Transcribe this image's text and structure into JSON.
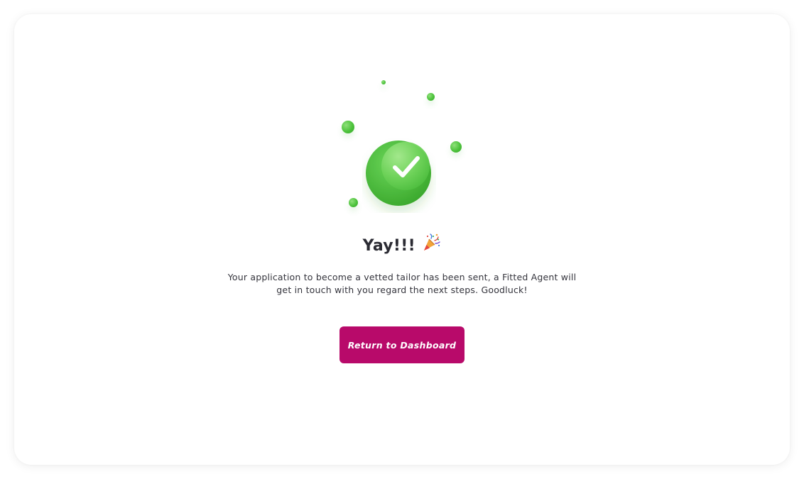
{
  "success": {
    "title": "Yay!!!",
    "message": "Your application to become a vetted tailor has been sent, a Fitted Agent will get in touch with you regard the next steps. Goodluck!",
    "title_icon": "party-popper-icon",
    "illustration_icon": "checkmark-circle-icon"
  },
  "actions": {
    "return_label": "Return to Dashboard"
  },
  "colors": {
    "accent": "#b80a6a",
    "success_green": "#4cc23b",
    "title_text": "#2b2b33",
    "body_text": "#34343c"
  }
}
